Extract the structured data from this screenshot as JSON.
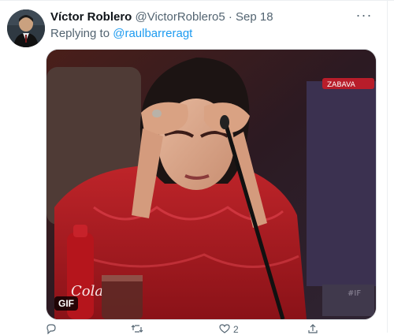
{
  "tweet": {
    "author_name": "Víctor Roblero",
    "handle": "@VictorRoblero5",
    "separator": "·",
    "date": "Sep 18",
    "more_label": "···",
    "reply_prefix": "Replying to",
    "reply_to": "@raulbarreragt"
  },
  "media": {
    "badge": "GIF",
    "watermark": "ZABAVA",
    "corner_mark": "#IF",
    "bottle_text": "Cola"
  },
  "actions": {
    "like_count": "2"
  },
  "colors": {
    "link": "#1d9bf0",
    "muted": "#536471"
  }
}
